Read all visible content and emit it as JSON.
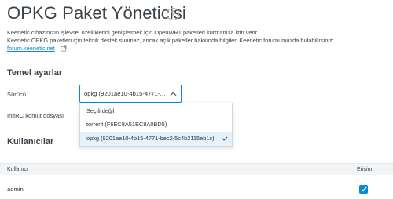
{
  "page": {
    "title": "OPKG Paket Yöneticisi",
    "help_glyph": "?"
  },
  "description": {
    "line1": "Keenetic cihazınızın işlevsel özelliklerini genişletmek için OpenWRT paketleri kurmanıza izin verir.",
    "line2": "Keenetic OPKG paketleri için teknik destek sunmaz, ancak açık paketler hakkında bilgileri Keenetic forumumuzda bulabilirsiniz:",
    "link": "forum.keenetic.net"
  },
  "basic_settings": {
    "heading": "Temel ayarlar",
    "driver_label": "Sürücü",
    "initrc_label": "InitRC komut dosyası",
    "driver_value": "opkg (9201ae10-4b15-4771-bec2-5c4b2115eb1c)",
    "driver_options": [
      {
        "label": "Seçili değil"
      },
      {
        "label": "torrent (F6EC8A51EC8A0BD5)"
      },
      {
        "label": "opkg (9201ae10-4b15-4771-bec2-5c4b2115eb1c)"
      }
    ]
  },
  "users": {
    "heading": "Kullanıcılar",
    "columns": {
      "user": "Kullanıcı",
      "access": "Erişim"
    },
    "rows": [
      {
        "user": "admin",
        "access": true
      }
    ]
  },
  "colors": {
    "accent": "#0a8ad6",
    "text": "#3b4248",
    "selected_bg": "#e6f2fb"
  },
  "icons": {
    "help": "question-circle-icon",
    "external": "external-link-icon",
    "caret": "chevron-up-icon",
    "check": "checkmark-icon"
  }
}
